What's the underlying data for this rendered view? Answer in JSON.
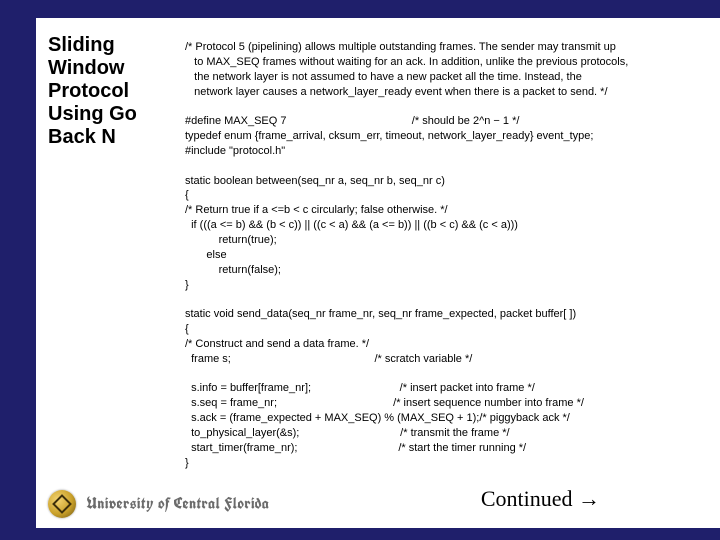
{
  "slide": {
    "title": "Sliding Window Protocol Using Go Back N",
    "continued": "Continued →",
    "university": "University of Central Florida",
    "logo_name": "ucf-seal"
  },
  "code_lines": [
    "/* Protocol 5 (pipelining) allows multiple outstanding frames. The sender may transmit up",
    "   to MAX_SEQ frames without waiting for an ack. In addition, unlike the previous protocols,",
    "   the network layer is not assumed to have a new packet all the time. Instead, the",
    "   network layer causes a network_layer_ready event when there is a packet to send. */",
    "",
    "#define MAX_SEQ 7                                         /* should be 2^n − 1 */",
    "typedef enum {frame_arrival, cksum_err, timeout, network_layer_ready} event_type;",
    "#include \"protocol.h\"",
    "",
    "static boolean between(seq_nr a, seq_nr b, seq_nr c)",
    "{",
    "/* Return true if a <=b < c circularly; false otherwise. */",
    "  if (((a <= b) && (b < c)) || ((c < a) && (a <= b)) || ((b < c) && (c < a)))",
    "           return(true);",
    "       else",
    "           return(false);",
    "}",
    "",
    "static void send_data(seq_nr frame_nr, seq_nr frame_expected, packet buffer[ ])",
    "{",
    "/* Construct and send a data frame. */",
    "  frame s;                                               /* scratch variable */",
    "",
    "  s.info = buffer[frame_nr];                             /* insert packet into frame */",
    "  s.seq = frame_nr;                                      /* insert sequence number into frame */",
    "  s.ack = (frame_expected + MAX_SEQ) % (MAX_SEQ + 1);/* piggyback ack */",
    "  to_physical_layer(&s);                                 /* transmit the frame */",
    "  start_timer(frame_nr);                                 /* start the timer running */",
    "}"
  ]
}
